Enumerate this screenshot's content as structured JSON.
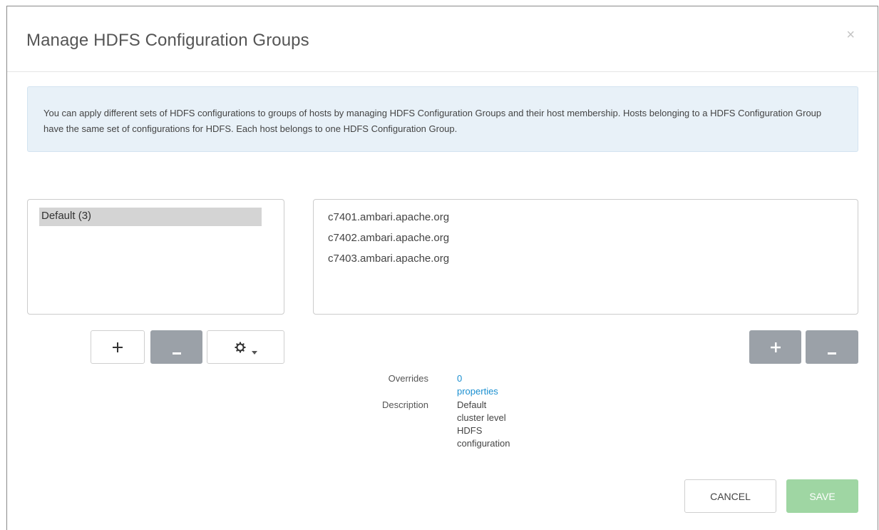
{
  "dialog": {
    "title": "Manage HDFS Configuration Groups",
    "close_glyph": "×"
  },
  "info": {
    "text": "You can apply different sets of HDFS configurations to groups of hosts by managing HDFS Configuration Groups and their host membership. Hosts belonging to a HDFS Configuration Group have the same set of configurations for HDFS. Each host belongs to one HDFS Configuration Group."
  },
  "groups": {
    "items": [
      {
        "label": "Default (3)",
        "selected": true
      }
    ]
  },
  "hosts": {
    "items": [
      "c7401.ambari.apache.org",
      "c7402.ambari.apache.org",
      "c7403.ambari.apache.org"
    ]
  },
  "group_actions": {
    "add_glyph": "+",
    "remove_glyph": "−",
    "settings_icon": "gear-icon",
    "dropdown_icon": "caret-down-icon"
  },
  "host_actions": {
    "add_glyph": "+",
    "remove_glyph": "−"
  },
  "details": {
    "overrides_label": "Overrides",
    "overrides_value": "0 properties",
    "description_label": "Description",
    "description_value": "Default cluster level HDFS configuration"
  },
  "footer": {
    "cancel_label": "CANCEL",
    "save_label": "SAVE"
  },
  "colors": {
    "accent_link": "#1a8fd0",
    "info_background": "#e8f1f8",
    "gray_button": "#9ba1a8",
    "save_button_disabled": "#9fd6a3",
    "selected_item": "#d4d4d4"
  }
}
